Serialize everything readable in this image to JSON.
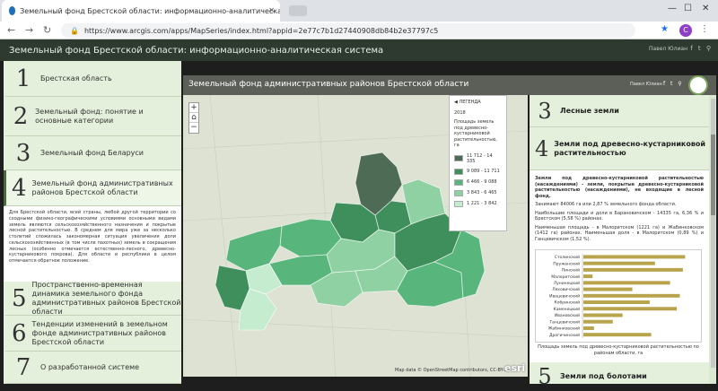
{
  "browser": {
    "tab_title": "Земельный фонд Брестской области: информационно-аналитическая система - Google Chrome",
    "url": "https://www.arcgis.com/apps/MapSeries/index.html?appid=2e77c7b1d27440908db84b2e37797c5",
    "profile_initial": "C"
  },
  "app": {
    "title": "Земельный фонд Брестской области: информационно-аналитическая система",
    "user": "Павел Юлиан"
  },
  "left": {
    "items": [
      {
        "num": "1",
        "label": "Брестская область"
      },
      {
        "num": "2",
        "label": "Земельный фонд: понятие и основные категории"
      },
      {
        "num": "3",
        "label": "Земельный фонд Беларуси"
      },
      {
        "num": "4",
        "label": "Земельный фонд административных районов Брестской области"
      },
      {
        "num": "5",
        "label": "Пространственно-временная динамика земельного фонда административных районов Брестской области"
      },
      {
        "num": "6",
        "label": "Тенденции изменений в земельном фонде административных районов Брестской области"
      },
      {
        "num": "7",
        "label": "О разработанной системе"
      }
    ],
    "text": "Для Брестской области, всей страны, любой другой территории со сходными физико-географическими условиями основными видами земель являются сельскохозяйственного назначения и покрытые лесной растительностью. В среднем для мира уже за несколько столетий сложилась закономерная ситуация увеличения доли сельскохозяйственных (в том числе пахотных) земель в сокращения лесных (особенно отмечается естественно-лесного, древесно-кустарникового покрова). Для области и республики в целом отмечается обратное положение."
  },
  "map": {
    "title": "Земельный фонд административных районов Брестской области",
    "user": "Павел Юлиан",
    "legend": {
      "header": "ЛЕГЕНДА",
      "year": "2018",
      "desc": "Площадь земель под древесно-кустарниковой растительностью, га",
      "classes": [
        {
          "label": "11 712 - 14 335",
          "color": "#4d6b55"
        },
        {
          "label": "9 089 - 11 711",
          "color": "#3f8f5c"
        },
        {
          "label": "6 466 - 9 088",
          "color": "#58b57b"
        },
        {
          "label": "3 843 - 6 465",
          "color": "#8fd1a3"
        },
        {
          "label": "1 221 - 3 842",
          "color": "#c6ecd0"
        }
      ]
    },
    "zoom_in": "+",
    "home": "⌂",
    "zoom_out": "−",
    "attribution": "Map data © OpenStreetMap contributors, CC-BY-SA",
    "esri": "esri"
  },
  "right": {
    "item3": {
      "num": "3",
      "label": "Лесные земли"
    },
    "item4": {
      "num": "4",
      "label": "Земли под древесно-кустарниковой растительностью"
    },
    "item5": {
      "num": "5",
      "label": "Земли под болотами"
    },
    "para1": "Земли под древесно-кустарниковой растительностью (насаждениями) - земли, покрытые древесно-кустарниковой растительностью (насаждениями), не входящие в лесной фонд.",
    "para2": "Занимают 84006 га или 2,87 % земельного фонда области.",
    "para3": "Наибольшие площади и доли в Барановичском - 14335 га, 6,36 % и Брестском (5,58 %) районах.",
    "para4": "Наименьшая площадь - в Малоритском (1221 га) и Жабинковском (1412 га) районах. Наименьшая доля - в Малоритском (0,89 %) и Ганцевичском (1,52 %).",
    "caption": "Площадь земель под древесно-кустарниковой растительностью по районам области, га"
  },
  "chart_data": {
    "type": "bar",
    "categories": [
      "Столинский",
      "Пружанский",
      "Пинский",
      "Малоритский",
      "Лунинецкий",
      "Ляховичский",
      "Ивацевичский",
      "Кобринский",
      "Каменецкий",
      "Ивановский",
      "Ганцевичский",
      "Жабинковский",
      "Дрогичинский"
    ],
    "values": [
      13500,
      9500,
      13200,
      1221,
      11500,
      6500,
      12800,
      8800,
      12400,
      5200,
      3900,
      1412,
      9000
    ],
    "title": "",
    "xlabel": "",
    "ylabel": "",
    "xlim": [
      0,
      15000
    ],
    "bar_color": "#b8a44c"
  }
}
